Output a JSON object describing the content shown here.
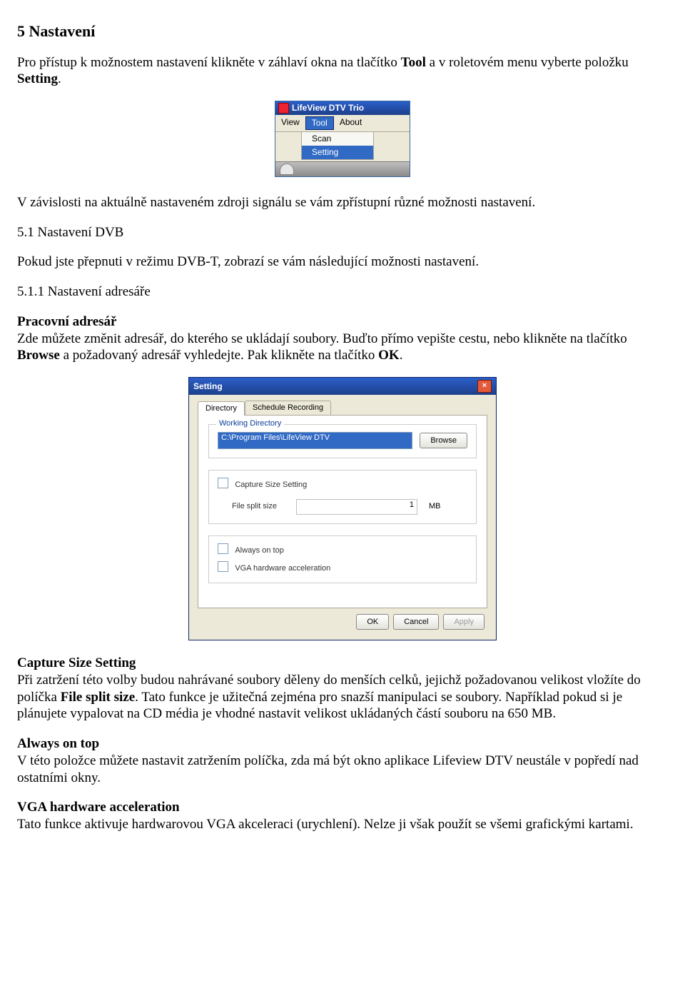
{
  "section_title": "5  Nastavení",
  "intro": {
    "pre": "Pro přístup k možnostem nastavení klikněte v záhlaví okna na tlačítko ",
    "bold1": "Tool",
    "mid": " a v roletovém menu vyberte položku ",
    "bold2": "Setting",
    "post": "."
  },
  "menu_img": {
    "title": "LifeView DTV Trio",
    "menu_items": {
      "view": "View",
      "tool": "Tool",
      "about": "About"
    },
    "sub": {
      "scan": "Scan",
      "setting": "Setting"
    }
  },
  "after_intro": "V závislosti na aktuálně nastaveném zdroji signálu se vám zpřístupní různé možnosti nastavení.",
  "sub1_title": "5.1 Nastavení DVB",
  "sub1_text": "Pokud jste přepnuti v režimu DVB-T, zobrazí se vám následující možnosti nastavení.",
  "sub11_title": "5.1.1 Nastavení adresáře",
  "workdir": {
    "heading": "Pracovní adresář",
    "line1_pre": "Zde můžete změnit adresář, do kterého se ukládají soubory. Buďto přímo vepište cestu, nebo klikněte na tlačítko ",
    "line1_bold1": "Browse",
    "line1_mid": " a požadovaný adresář vyhledejte. Pak klikněte na tlačítko ",
    "line1_bold2": "OK",
    "line1_post": "."
  },
  "dialog": {
    "title": "Setting",
    "tabs": {
      "directory": "Directory",
      "schedule": "Schedule Recording"
    },
    "group_workdir": "Working Directory",
    "path_value": "C:\\Program Files\\LifeView DTV",
    "browse_btn": "Browse",
    "capture_chk": "Capture Size Setting",
    "file_split_label": "File split size",
    "file_split_value": "1",
    "mb_label": "MB",
    "always_chk": "Always on top",
    "vga_chk": "VGA hardware acceleration",
    "ok_btn": "OK",
    "cancel_btn": "Cancel",
    "apply_btn": "Apply"
  },
  "capture": {
    "heading": "Capture Size Setting",
    "pre": "Při zatržení této volby budou nahrávané soubory děleny do menších celků, jejichž požadovanou velikost vložíte do políčka ",
    "bold": "File split size",
    "post": ". Tato funkce je užitečná zejména pro snazší manipulaci se soubory. Například pokud si je plánujete vypalovat na CD média je vhodné nastavit velikost ukládaných částí souboru na 650 MB."
  },
  "always": {
    "heading": "Always on top",
    "text": "V této položce můžete nastavit zatržením políčka, zda má být okno aplikace Lifeview DTV neustále v popředí nad ostatními okny."
  },
  "vga": {
    "heading": "VGA hardware acceleration",
    "text": "Tato funkce aktivuje hardwarovou VGA akceleraci (urychlení). Nelze ji však použít se všemi grafickými kartami."
  }
}
